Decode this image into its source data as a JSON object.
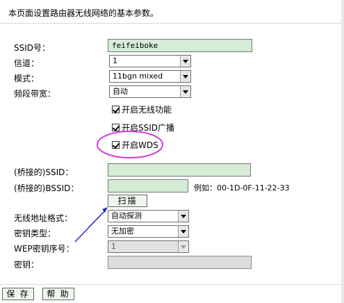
{
  "intro": "本页面设置路由器无线网络的基本参数。",
  "fields": {
    "ssid_label": "SSID号：",
    "ssid_value": "feifeiboke",
    "channel_label": "信道：",
    "channel_value": "1",
    "mode_label": "模式：",
    "mode_value": "11bgn mixed",
    "bandwidth_label": "频段带宽：",
    "bandwidth_value": "自动"
  },
  "checkboxes": {
    "enable_wireless": "开启无线功能",
    "enable_ssid_broadcast": "开启SSID广播",
    "enable_wds": "开启WDS"
  },
  "wds": {
    "bridged_ssid_label": "(桥接的)SSID：",
    "bridged_bssid_label": "(桥接的)BSSID：",
    "bssid_example": "例如：00-1D-0F-11-22-33",
    "scan_button": "扫描",
    "addr_format_label": "无线地址格式：",
    "addr_format_value": "自动探测",
    "key_type_label": "密钥类型：",
    "key_type_value": "无加密",
    "wep_index_label": "WEP密钥序号：",
    "wep_index_value": "1",
    "key_label": "密钥："
  },
  "buttons": {
    "save": "保 存",
    "help": "帮 助"
  },
  "colors": {
    "input_bg": "#d7ecd7",
    "annotation_circle": "#d63ad6",
    "annotation_arrow": "#1f2fb8"
  }
}
